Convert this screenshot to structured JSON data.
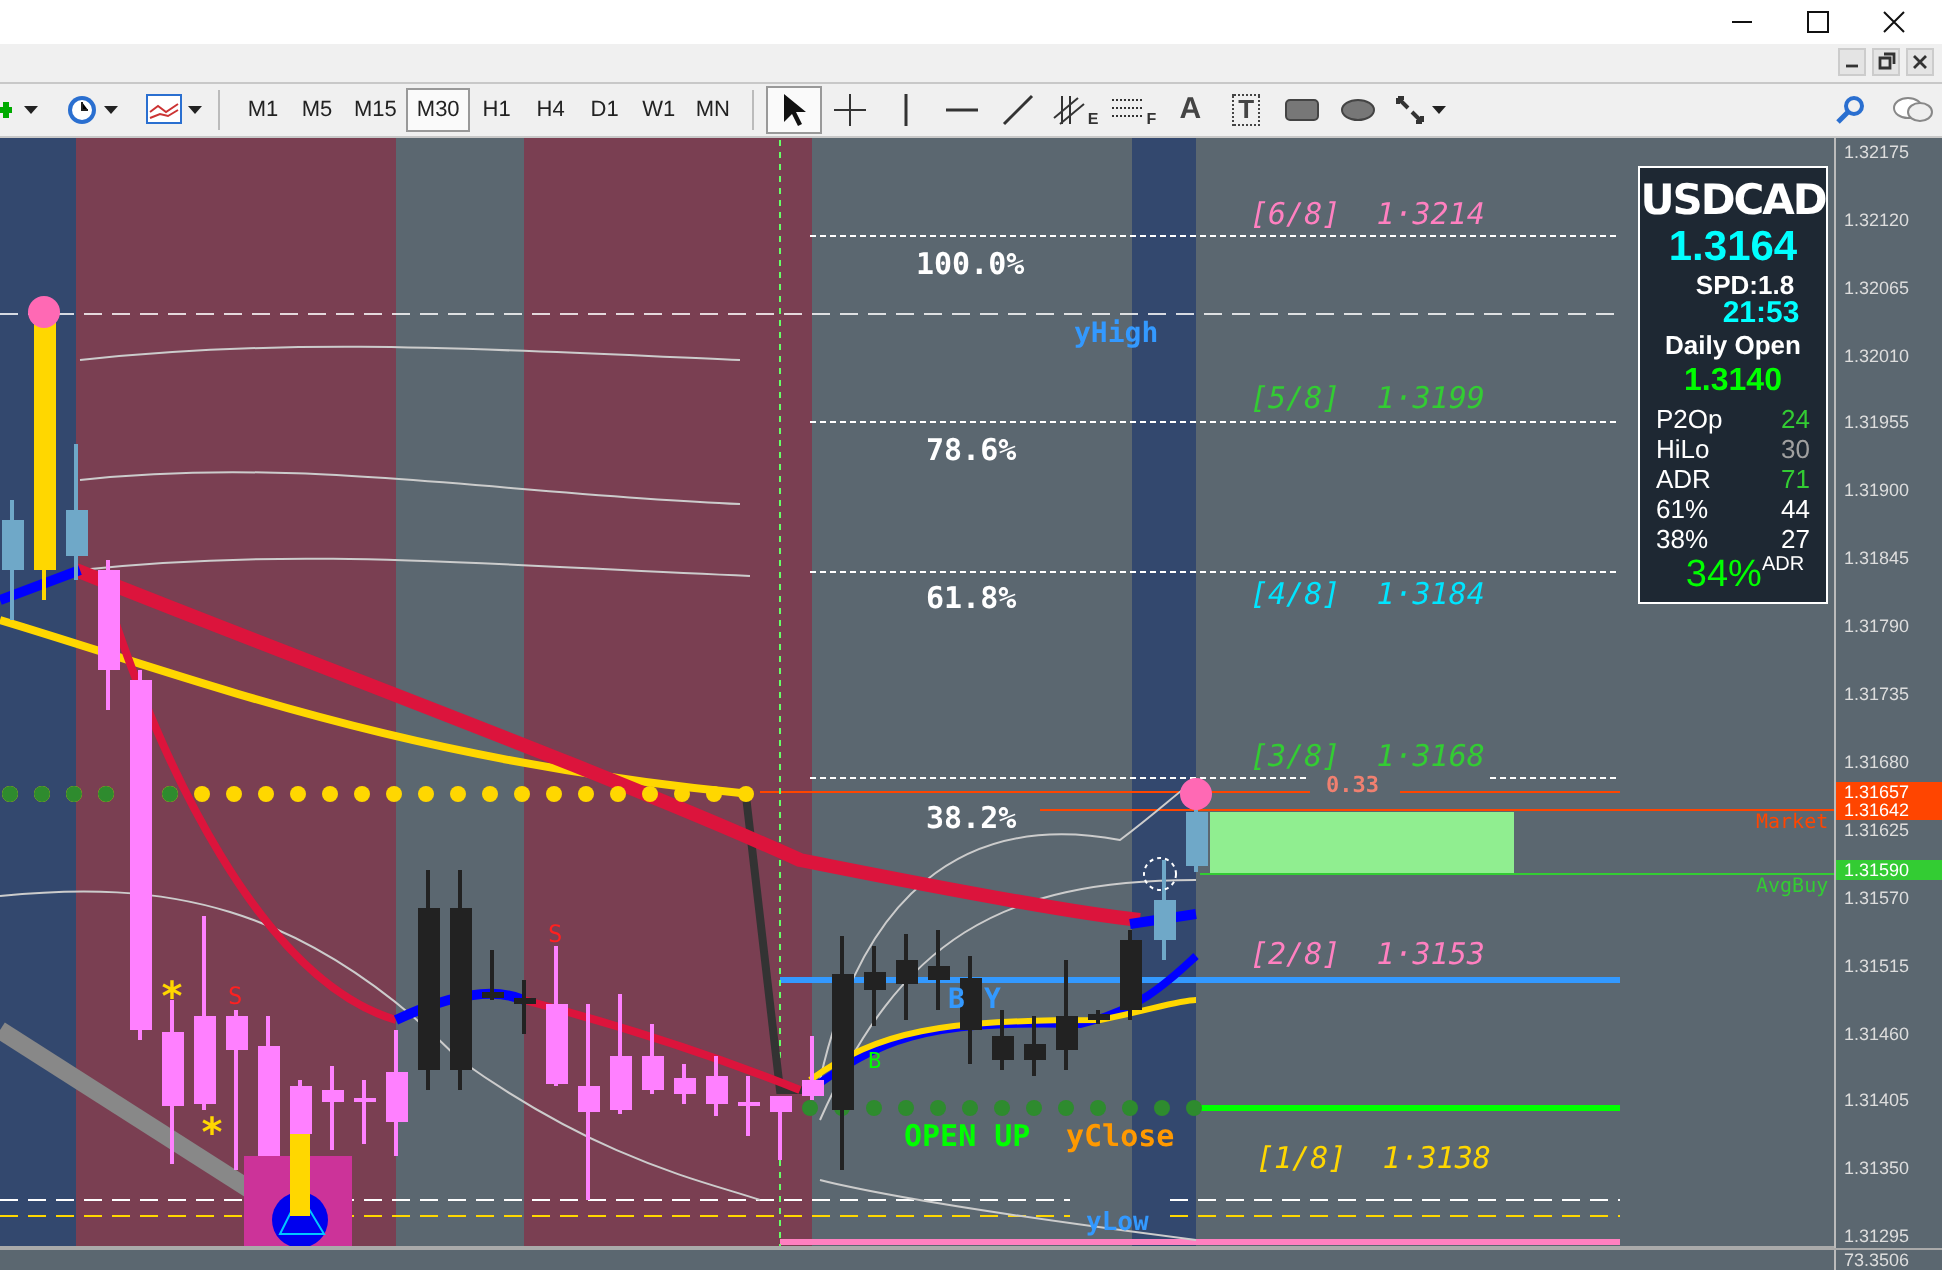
{
  "toolbar": {
    "timeframes": [
      {
        "label": "M1",
        "selected": false
      },
      {
        "label": "M5",
        "selected": false
      },
      {
        "label": "M15",
        "selected": false
      },
      {
        "label": "M30",
        "selected": true
      },
      {
        "label": "H1",
        "selected": false
      },
      {
        "label": "H4",
        "selected": false
      },
      {
        "label": "D1",
        "selected": false
      },
      {
        "label": "W1",
        "selected": false
      },
      {
        "label": "MN",
        "selected": false
      }
    ],
    "tools": [
      {
        "kind": "cursor",
        "selected": true
      },
      {
        "kind": "crosshair",
        "selected": false
      },
      {
        "kind": "vline",
        "selected": false
      },
      {
        "kind": "hline",
        "selected": false
      },
      {
        "kind": "trendline",
        "selected": false
      },
      {
        "kind": "channel",
        "label": "E",
        "selected": false
      },
      {
        "kind": "fibo",
        "label": "F",
        "selected": false
      },
      {
        "kind": "text",
        "label": "A",
        "selected": false
      },
      {
        "kind": "textlabel",
        "label": "T",
        "selected": false
      },
      {
        "kind": "rectangle",
        "selected": false
      },
      {
        "kind": "ellipse",
        "selected": false
      },
      {
        "kind": "arrows",
        "selected": false
      }
    ]
  },
  "chart": {
    "fib_levels": [
      "100.0%",
      "78.6%",
      "61.8%",
      "38.2%"
    ],
    "murrey_levels": [
      {
        "label": "[6/8]  1·3214",
        "color": "#ff80c0"
      },
      {
        "label": "[5/8]  1·3199",
        "color": "#33cc33"
      },
      {
        "label": "[4/8]  1·3184",
        "color": "#00e5ff"
      },
      {
        "label": "[3/8]  1·3168",
        "color": "#33cc33"
      },
      {
        "label": "[2/8]  1·3153",
        "color": "#ff80c0"
      },
      {
        "label": "[1/8]  1·3138",
        "color": "#ffd700"
      }
    ],
    "annotations": [
      {
        "text": "yHigh",
        "color": "#3399ff"
      },
      {
        "text": "0.33",
        "color": "#f08070"
      },
      {
        "text": "Market",
        "color": "#ff4500"
      },
      {
        "text": "AvgBuy",
        "color": "#33cc33"
      },
      {
        "text": "B",
        "color": "#3399ff"
      },
      {
        "text": "Y",
        "color": "#3399ff"
      },
      {
        "text": "B",
        "color": "#00ff00"
      },
      {
        "text": "OPEN UP",
        "color": "#00ff00"
      },
      {
        "text": "yClose",
        "color": "#ff9900"
      },
      {
        "text": "yLow",
        "color": "#3399ff"
      },
      {
        "text": "S",
        "color": "#ff2020"
      },
      {
        "text": "S",
        "color": "#ff2020"
      },
      {
        "text": "*",
        "color": "#ffd700"
      },
      {
        "text": "*",
        "color": "#ffd700"
      }
    ]
  },
  "info_panel": {
    "symbol": "USDCAD",
    "price": "1.3164",
    "spread": "SPD:1.8",
    "time": "21:53",
    "daily_open_label": "Daily Open",
    "daily_open": "1.3140",
    "stats": [
      {
        "name": "P2Op",
        "value": "24",
        "color": "#33cc33"
      },
      {
        "name": "HiLo",
        "value": "30",
        "color": "#a0a0a0"
      },
      {
        "name": "ADR",
        "value": "71",
        "color": "#33cc33"
      },
      {
        "name": "61%",
        "value": "44",
        "color": "#ffffff"
      },
      {
        "name": "38%",
        "value": "27",
        "color": "#ffffff"
      }
    ],
    "percent": "34%",
    "percent_suffix": "ADR"
  },
  "price_axis": {
    "ticks": [
      "1.32175",
      "1.32120",
      "1.32065",
      "1.32010",
      "1.31955",
      "1.31900",
      "1.31845",
      "1.31790",
      "1.31735",
      "1.31680",
      "1.31625",
      "1.31570",
      "1.31515",
      "1.31460",
      "1.31405",
      "1.31350",
      "1.31295"
    ],
    "tags": [
      {
        "label": "1.31657",
        "color": "#ff4500"
      },
      {
        "label": "1.31642",
        "color": "#ff4500"
      },
      {
        "label": "1.31590",
        "color": "#33cc33"
      }
    ]
  },
  "subwindow": {
    "reading": "73.3506"
  }
}
